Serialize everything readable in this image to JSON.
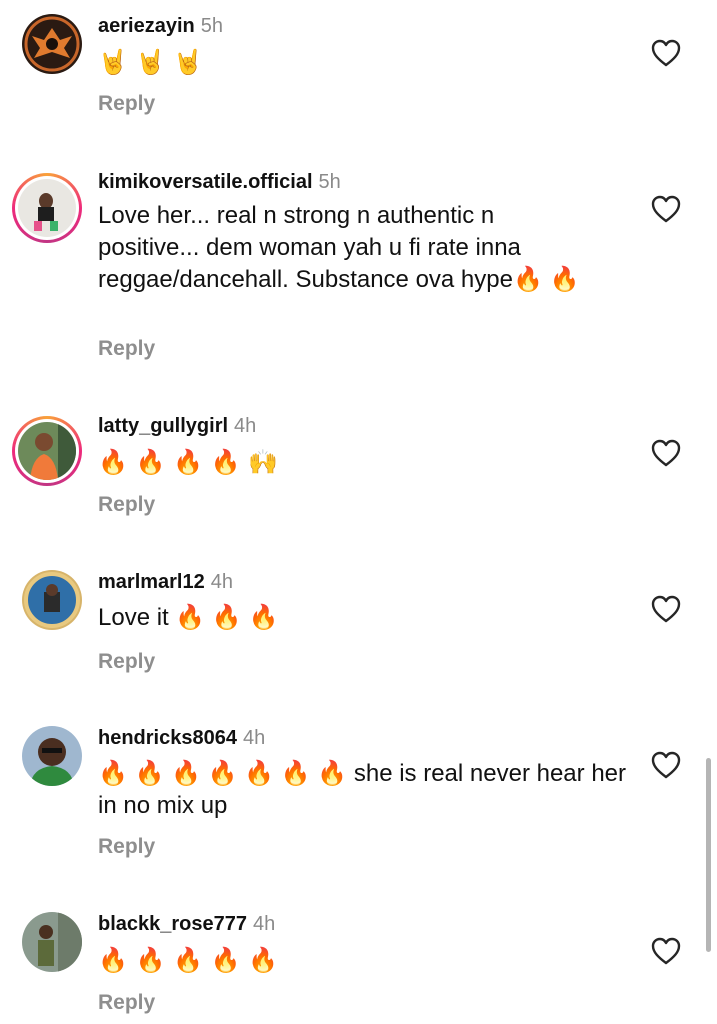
{
  "comments": [
    {
      "username": "aeriezayin",
      "time": "5h",
      "text": "🤘 🤘 🤘",
      "reply": "Reply"
    },
    {
      "username": "kimikoversatile.official",
      "time": "5h",
      "text": "Love her... real n strong n authentic n positive... dem woman yah u fi rate inna reggae/dancehall. Substance ova hype🔥 🔥",
      "reply": "Reply"
    },
    {
      "username": "latty_gullygirl",
      "time": "4h",
      "text": "🔥 🔥 🔥 🔥 🙌",
      "reply": "Reply"
    },
    {
      "username": "marlmarl12",
      "time": "4h",
      "text": "Love it 🔥 🔥 🔥",
      "reply": "Reply"
    },
    {
      "username": "hendricks8064",
      "time": "4h",
      "text": "🔥 🔥 🔥 🔥 🔥 🔥 🔥 she is real never hear her in no mix up",
      "reply": "Reply"
    },
    {
      "username": "blackk_rose777",
      "time": "4h",
      "text": "🔥 🔥 🔥 🔥 🔥",
      "reply": "Reply"
    }
  ],
  "icons": {
    "like": "heart-outline-icon"
  },
  "colors": {
    "story_ring_start": "#f9a23a",
    "story_ring_end": "#c13584",
    "secondary_text": "#8e8e8e"
  }
}
